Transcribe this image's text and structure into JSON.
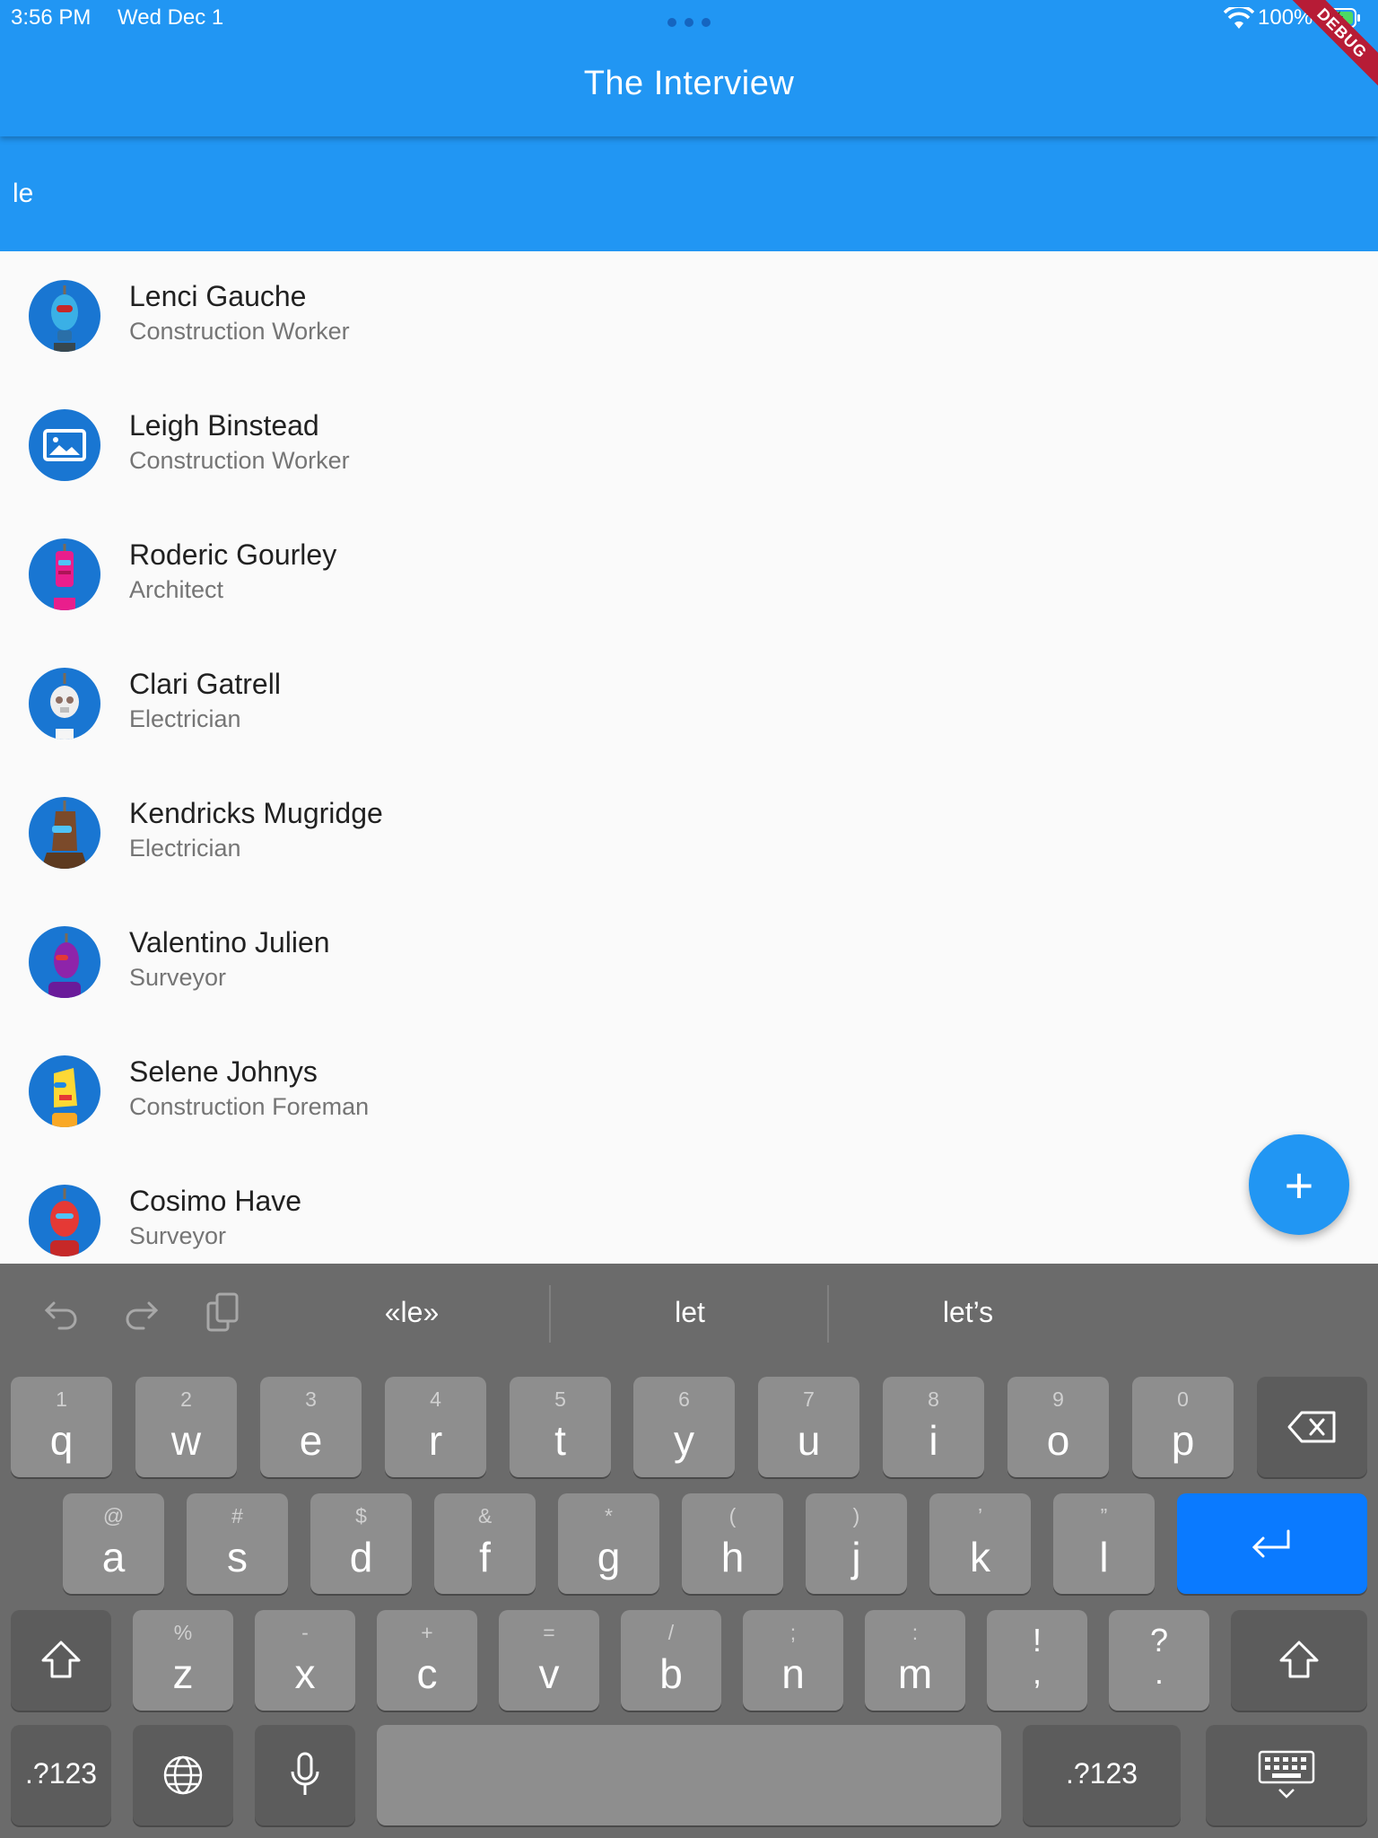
{
  "status_bar": {
    "time": "3:56 PM",
    "date": "Wed Dec 1",
    "battery": "100%",
    "wifi_icon": "wifi-icon",
    "battery_icon": "battery-charging-icon"
  },
  "debug_banner": "DEBUG",
  "app_bar": {
    "title": "The Interview"
  },
  "search": {
    "value": "le"
  },
  "contacts": [
    {
      "name": "Lenci Gauche",
      "role": "Construction Worker",
      "avatar": "robot-blue"
    },
    {
      "name": "Leigh Binstead",
      "role": "Construction Worker",
      "avatar": "image-placeholder-icon"
    },
    {
      "name": "Roderic Gourley",
      "role": "Architect",
      "avatar": "robot-pink"
    },
    {
      "name": "Clari Gatrell",
      "role": "Electrician",
      "avatar": "robot-white"
    },
    {
      "name": "Kendricks Mugridge",
      "role": "Electrician",
      "avatar": "robot-brown"
    },
    {
      "name": "Valentino Julien",
      "role": "Surveyor",
      "avatar": "robot-purple"
    },
    {
      "name": "Selene Johnys",
      "role": "Construction Foreman",
      "avatar": "robot-yellow"
    },
    {
      "name": "Cosimo Have",
      "role": "Surveyor",
      "avatar": "robot-red"
    }
  ],
  "fab": {
    "label": "+",
    "icon": "add-icon"
  },
  "keyboard": {
    "suggestions": [
      "«le»",
      "let",
      "let’s"
    ],
    "row1": [
      {
        "hint": "1",
        "key": "q"
      },
      {
        "hint": "2",
        "key": "w"
      },
      {
        "hint": "3",
        "key": "e"
      },
      {
        "hint": "4",
        "key": "r"
      },
      {
        "hint": "5",
        "key": "t"
      },
      {
        "hint": "6",
        "key": "y"
      },
      {
        "hint": "7",
        "key": "u"
      },
      {
        "hint": "8",
        "key": "i"
      },
      {
        "hint": "9",
        "key": "o"
      },
      {
        "hint": "0",
        "key": "p"
      }
    ],
    "row2": [
      {
        "hint": "@",
        "key": "a"
      },
      {
        "hint": "#",
        "key": "s"
      },
      {
        "hint": "$",
        "key": "d"
      },
      {
        "hint": "&",
        "key": "f"
      },
      {
        "hint": "*",
        "key": "g"
      },
      {
        "hint": "(",
        "key": "h"
      },
      {
        "hint": ")",
        "key": "j"
      },
      {
        "hint": "’",
        "key": "k"
      },
      {
        "hint": "”",
        "key": "l"
      }
    ],
    "row3": [
      {
        "hint": "%",
        "key": "z"
      },
      {
        "hint": "-",
        "key": "x"
      },
      {
        "hint": "+",
        "key": "c"
      },
      {
        "hint": "=",
        "key": "v"
      },
      {
        "hint": "/",
        "key": "b"
      },
      {
        "hint": ";",
        "key": "n"
      },
      {
        "hint": ":",
        "key": "m"
      }
    ],
    "punct1": {
      "top": "!",
      "bottom": ","
    },
    "punct2": {
      "top": "?",
      "bottom": "."
    },
    "numbers_label": ".?123",
    "colors": {
      "return_key": "#0a7aff",
      "key": "#8e8e8e",
      "background": "#6b6b6b"
    }
  }
}
